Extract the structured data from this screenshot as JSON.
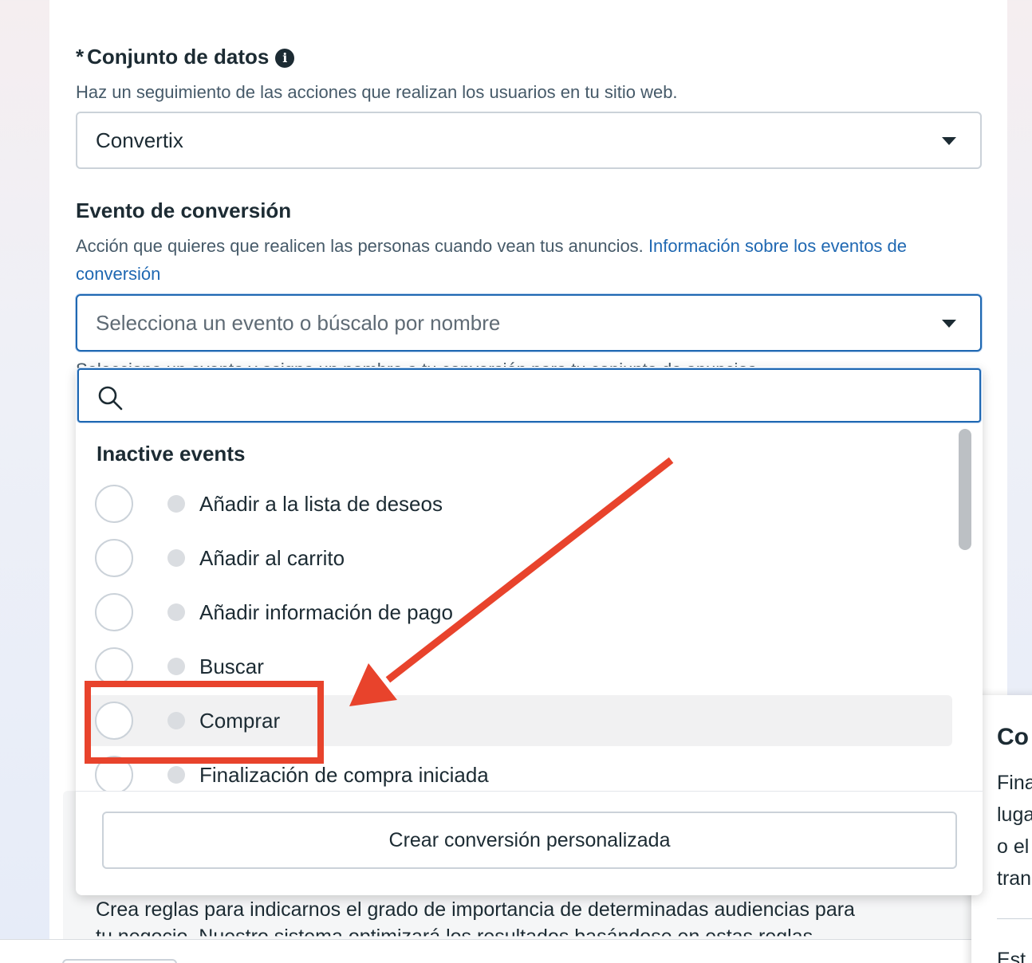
{
  "dataset_section": {
    "required_marker": "*",
    "title": "Conjunto de datos",
    "info_glyph": "i",
    "helper": "Haz un seguimiento de las acciones que realizan los usuarios en tu sitio web.",
    "selected_value": "Convertix"
  },
  "conversion_event_section": {
    "title": "Evento de conversión",
    "helper": "Acción que quieres que realicen las personas cuando vean tus anuncios.",
    "helper_link": "Información sobre los eventos de conversión",
    "select_placeholder": "Selecciona un evento o búscalo por nombre",
    "hidden_helper": "Selecciona un evento y asigna un nombre a tu conversión para tu conjunto de anuncios"
  },
  "dropdown": {
    "search_value": "",
    "group_title": "Inactive events",
    "options": [
      {
        "label": "Añadir a la lista de deseos",
        "status": "inactive"
      },
      {
        "label": "Añadir al carrito",
        "status": "inactive"
      },
      {
        "label": "Añadir información de pago",
        "status": "inactive"
      },
      {
        "label": "Buscar",
        "status": "inactive"
      },
      {
        "label": "Comprar",
        "status": "inactive",
        "hovered": true,
        "highlighted": true
      },
      {
        "label": "Finalización de compra iniciada",
        "status": "inactive"
      }
    ],
    "custom_conversion_button": "Crear conversión personalizada"
  },
  "behind_content": {
    "line1": "Crea reglas para indicarnos el grado de importancia de determinadas audiencias para",
    "line2": "tu negocio. Nuestro sistema optimizará los resultados basándose en estas reglas"
  },
  "side_panel": {
    "title": "Co",
    "lines": [
      "Fina",
      "luga",
      "o el",
      "tran"
    ],
    "footer": "Est"
  },
  "annotation": {
    "arrow_color": "#e8432c",
    "highlight_color": "#e8432c"
  },
  "colors": {
    "link": "#1f68b2",
    "focus_border": "#1f68b2",
    "text": "#1c2b33"
  }
}
